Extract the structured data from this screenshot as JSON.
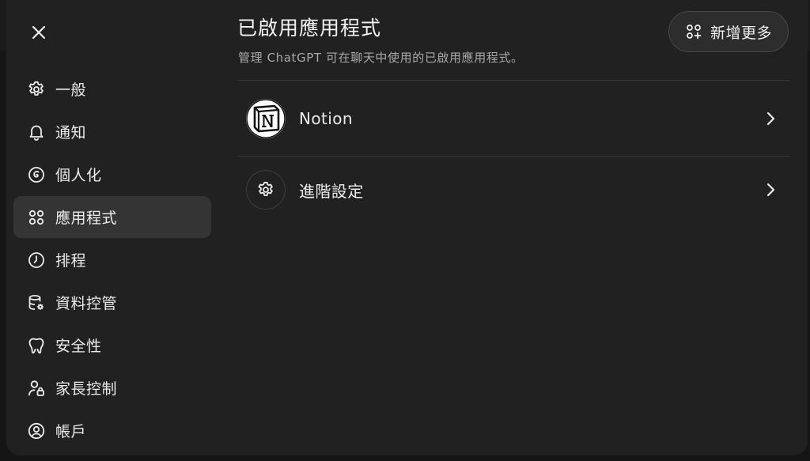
{
  "modal": {
    "close_icon": "close-icon"
  },
  "sidebar": {
    "items": [
      {
        "label": "一般",
        "icon": "gear-icon",
        "active": false
      },
      {
        "label": "通知",
        "icon": "bell-icon",
        "active": false
      },
      {
        "label": "個人化",
        "icon": "personalization-icon",
        "active": false
      },
      {
        "label": "應用程式",
        "icon": "apps-grid-icon",
        "active": true
      },
      {
        "label": "排程",
        "icon": "clock-icon",
        "active": false
      },
      {
        "label": "資料控管",
        "icon": "database-gear-icon",
        "active": false
      },
      {
        "label": "安全性",
        "icon": "shield-icon",
        "active": false
      },
      {
        "label": "家長控制",
        "icon": "user-lock-icon",
        "active": false
      },
      {
        "label": "帳戶",
        "icon": "account-icon",
        "active": false
      }
    ]
  },
  "main": {
    "title": "已啟用應用程式",
    "subtitle": "管理 ChatGPT 可在聊天中使用的已啟用應用程式。",
    "add_button": {
      "label": "新增更多",
      "icon": "apps-add-icon"
    },
    "rows": [
      {
        "label": "Notion",
        "icon": "notion-logo-icon"
      },
      {
        "label": "進階設定",
        "icon": "gear-icon"
      }
    ]
  },
  "colors": {
    "background": "#212121",
    "active_item": "#343434",
    "text": "#ececec",
    "muted_text": "#a9a9a9"
  }
}
